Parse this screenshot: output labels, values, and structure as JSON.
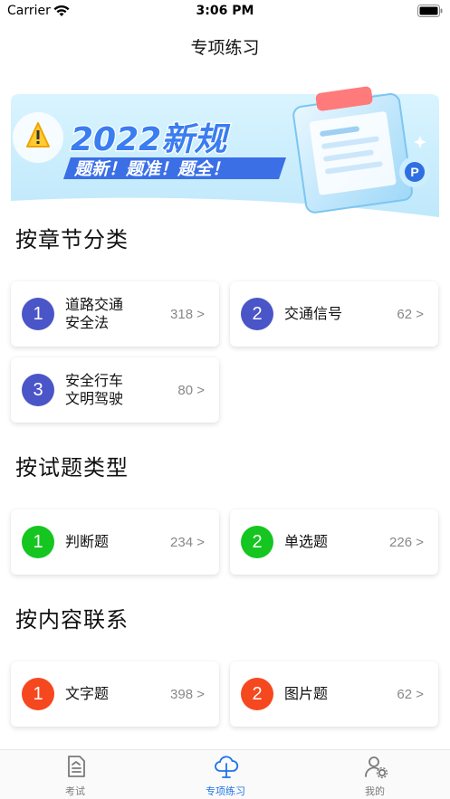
{
  "status_bar": {
    "carrier": "Carrier",
    "time": "3:06 PM"
  },
  "nav": {
    "title": "专项练习"
  },
  "banner": {
    "headline": "2022新规",
    "tagline": "题新！题准！题全！",
    "colors": {
      "sky": "#cfeefe",
      "headline": "#3a7df0",
      "tagline_bg": "#3b6fe6"
    }
  },
  "sections": [
    {
      "title": "按章节分类",
      "accent": "#4a55c8",
      "items": [
        {
          "num": "1",
          "label": "道路交通\n安全法",
          "count": "318 >"
        },
        {
          "num": "2",
          "label": "交通信号",
          "count": "62 >"
        },
        {
          "num": "3",
          "label": "安全行车\n文明驾驶",
          "count": "80 >"
        }
      ]
    },
    {
      "title": "按试题类型",
      "accent": "#15c520",
      "items": [
        {
          "num": "1",
          "label": "判断题",
          "count": "234 >"
        },
        {
          "num": "2",
          "label": "单选题",
          "count": "226 >"
        }
      ]
    },
    {
      "title": "按内容联系",
      "accent": "#f5481f",
      "items": [
        {
          "num": "1",
          "label": "文字题",
          "count": "398 >"
        },
        {
          "num": "2",
          "label": "图片题",
          "count": "62 >"
        }
      ]
    }
  ],
  "tab_bar": {
    "items": [
      {
        "label": "考试",
        "icon": "exam-paper-icon"
      },
      {
        "label": "专项练习",
        "icon": "practice-cloud-icon",
        "active": true
      },
      {
        "label": "我的",
        "icon": "profile-gear-icon"
      }
    ],
    "active_color": "#1e73e8"
  }
}
